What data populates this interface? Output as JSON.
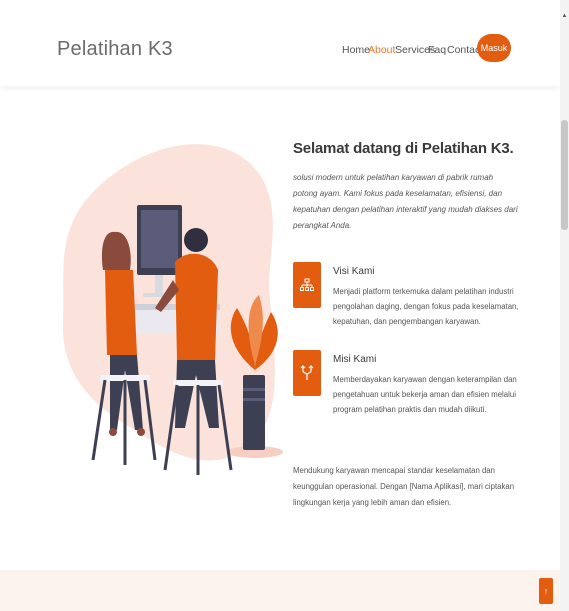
{
  "header": {
    "logo": "Pelatihan K3",
    "nav": [
      {
        "label": "Home",
        "active": false
      },
      {
        "label": "About",
        "active": true
      },
      {
        "label": "Services",
        "active": false
      },
      {
        "label": "Faq",
        "active": false
      },
      {
        "label": "Contact",
        "active": false
      }
    ],
    "cta_label": "Masuk"
  },
  "about": {
    "heading": "Selamat datang di Pelatihan K3.",
    "intro": "solusi modern untuk pelatihan karyawan di pabrik rumah potong ayam. Kami fokus pada keselamatan, efisiensi, dan kepatuhan dengan pelatihan interaktif yang mudah diakses dari perangkat Anda.",
    "features": [
      {
        "icon": "network-icon",
        "title": "Visi Kami",
        "desc": "Menjadi platform terkemuka dalam pelatihan industri pengolahan daging, dengan fokus pada keselamatan, kepatuhan, dan pengembangan karyawan."
      },
      {
        "icon": "arrows-split-icon",
        "title": "Misi Kami",
        "desc": "Memberdayakan karyawan dengan keterampilan dan pengetahuan untuk bekerja aman dan efisien melalui program pelatihan praktis dan mudah diikuti."
      }
    ],
    "closing": "Mendukung karyawan mencapai standar keselamatan dan keunggulan operasional. Dengan [Nama Aplikasi], mari ciptakan lingkungan kerja yang lebih aman dan efisien."
  },
  "colors": {
    "accent": "#e35d11",
    "blob": "#fbe3dc",
    "footer_band": "#fdf3ee"
  },
  "back_to_top_icon": "arrow-up-icon"
}
